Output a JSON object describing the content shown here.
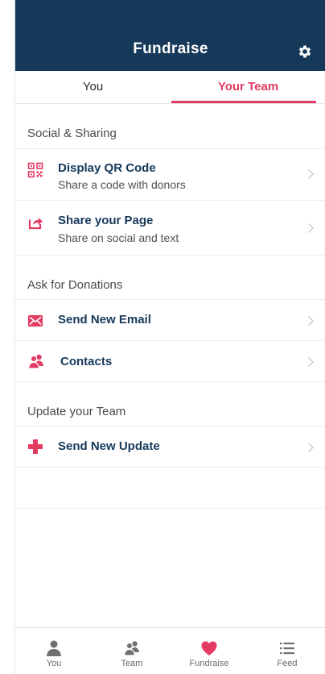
{
  "header": {
    "title": "Fundraise"
  },
  "tabs": [
    {
      "label": "You"
    },
    {
      "label": "Your Team"
    }
  ],
  "sections": [
    {
      "title": "Social & Sharing"
    },
    {
      "title": "Ask for Donations"
    },
    {
      "title": "Update your Team"
    }
  ],
  "items": {
    "qr": {
      "title": "Display QR Code",
      "subtitle": "Share a code with donors",
      "icon": "qr-code-icon"
    },
    "share": {
      "title": "Share your Page",
      "subtitle": "Share on social and text",
      "icon": "share-icon"
    },
    "email": {
      "title": "Send New Email",
      "icon": "envelope-icon"
    },
    "contacts": {
      "title": "Contacts",
      "icon": "contacts-icon"
    },
    "update": {
      "title": "Send New Update",
      "icon": "plus-icon"
    }
  },
  "bottom_nav": [
    {
      "label": "You",
      "icon": "person-icon"
    },
    {
      "label": "Team",
      "icon": "team-icon"
    },
    {
      "label": "Fundraise",
      "icon": "heart-icon"
    },
    {
      "label": "Feed",
      "icon": "list-icon"
    }
  ],
  "colors": {
    "header_bg": "#16395a",
    "accent": "#e33b63",
    "item_title": "#16395a"
  }
}
